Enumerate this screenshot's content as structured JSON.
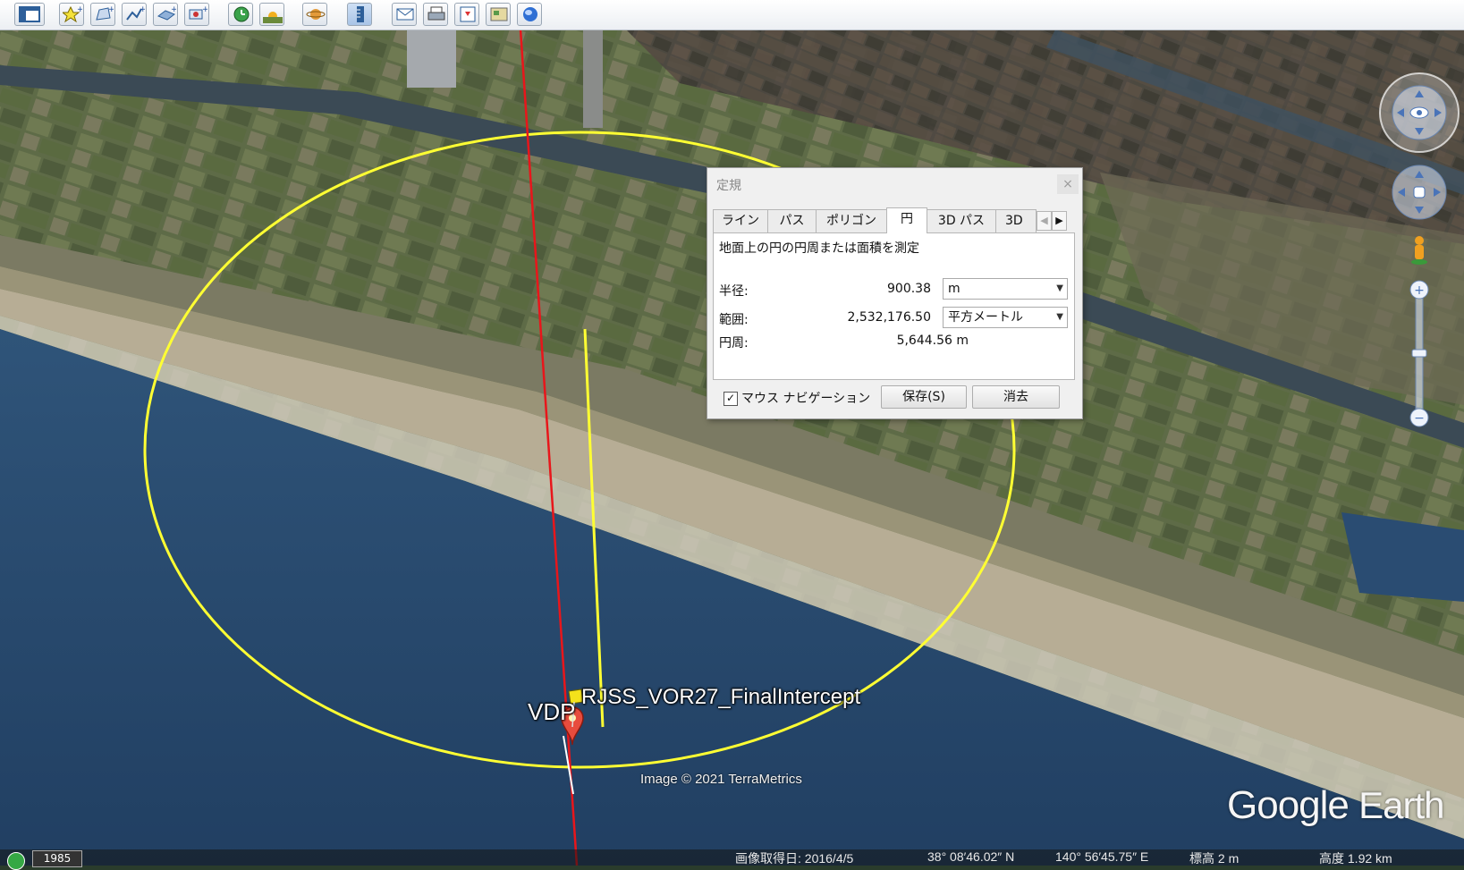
{
  "toolbar": {
    "icons": [
      "sidebar-toggle-icon",
      "add-placemark-icon",
      "add-polygon-icon",
      "add-path-icon",
      "add-image-overlay-icon",
      "record-tour-icon",
      "historical-imagery-icon",
      "sunlight-icon",
      "planet-icon",
      "ruler-icon",
      "email-icon",
      "print-icon",
      "save-image-icon",
      "view-in-maps-icon",
      "earth-icon"
    ]
  },
  "map": {
    "placemarks": [
      {
        "label": "VDP"
      },
      {
        "label": "RJSS_VOR27_FinalIntercept"
      }
    ],
    "copyright": "Image © 2021 TerraMetrics",
    "logo": {
      "google": "Google",
      "earth": "Earth"
    },
    "colors": {
      "circle": "#ffff33",
      "course_line": "#e8161b",
      "sea": "#27476b",
      "land": "#5b6a45"
    }
  },
  "status_bar": {
    "year": "1985",
    "imagery_date": "画像取得日: 2016/4/5",
    "latitude": "38° 08′46.02″ N",
    "longitude": "140° 56′45.75″ E",
    "elevation": "標高  2 m",
    "eye_altitude": "高度  1.92 km"
  },
  "ruler": {
    "title": "定規",
    "close_label": "×",
    "tabs": [
      {
        "label": "ライン",
        "active": false
      },
      {
        "label": "パス",
        "active": false
      },
      {
        "label": "ポリゴン",
        "active": false
      },
      {
        "label": "円",
        "active": true
      },
      {
        "label": "3D パス",
        "active": false
      },
      {
        "label": "3D ",
        "active": false
      }
    ],
    "description": "地面上の円の円周または面積を測定",
    "radius": {
      "label": "半径:",
      "value": "900.38",
      "unit": "m"
    },
    "area": {
      "label": "範囲:",
      "value": "2,532,176.50",
      "unit": "平方メートル"
    },
    "circumference": {
      "label": "円周:",
      "value": "5,644.56 m"
    },
    "mouse_navigation": {
      "label": "マウス ナビゲーション",
      "checked": true
    },
    "save_label": "保存(S)",
    "clear_label": "消去"
  }
}
